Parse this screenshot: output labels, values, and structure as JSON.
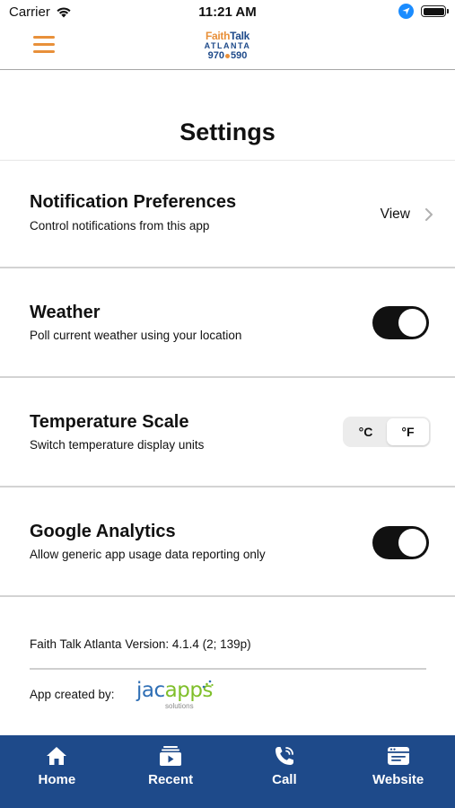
{
  "status_bar": {
    "carrier": "Carrier",
    "time": "11:21 AM"
  },
  "header": {
    "logo_faith": "Faith",
    "logo_talk": "Talk",
    "logo_city": "ATLANTA",
    "logo_freq_a": "970",
    "logo_freq_b": "590"
  },
  "page": {
    "title": "Settings"
  },
  "settings": {
    "notifications": {
      "title": "Notification Preferences",
      "subtitle": "Control notifications from this app",
      "action_label": "View"
    },
    "weather": {
      "title": "Weather",
      "subtitle": "Poll current weather using your location",
      "enabled": true
    },
    "temperature": {
      "title": "Temperature Scale",
      "subtitle": "Switch temperature display units",
      "options": [
        "°C",
        "°F"
      ],
      "selected": "°F"
    },
    "analytics": {
      "title": "Google Analytics",
      "subtitle": "Allow generic app usage data reporting only",
      "enabled": true
    }
  },
  "footer": {
    "version": "Faith Talk Atlanta Version: 4.1.4 (2; 139p)",
    "created_by": "App created by:",
    "brand_a": "jac",
    "brand_b": "apps",
    "brand_sub": "solutions"
  },
  "tabs": [
    {
      "label": "Home",
      "icon": "home-icon"
    },
    {
      "label": "Recent",
      "icon": "recent-icon"
    },
    {
      "label": "Call",
      "icon": "phone-icon"
    },
    {
      "label": "Website",
      "icon": "browser-icon"
    }
  ],
  "colors": {
    "brand_navy": "#1e4a8a",
    "brand_orange": "#e8903a",
    "toggle_on": "#111111"
  }
}
